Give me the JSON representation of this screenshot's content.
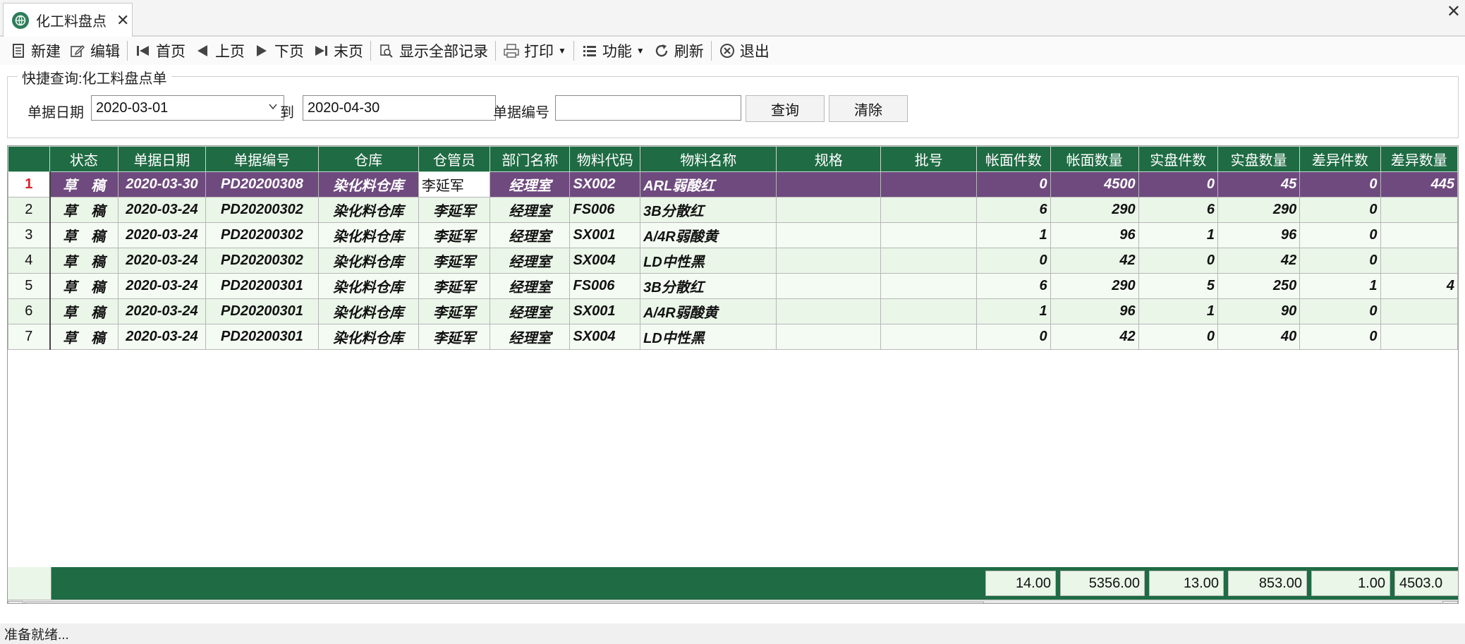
{
  "tab": {
    "title": "化工料盘点",
    "close": "✕"
  },
  "window": {
    "close": "✕"
  },
  "toolbar": {
    "new": "新建",
    "edit": "编辑",
    "first": "首页",
    "prev": "上页",
    "next": "下页",
    "last": "末页",
    "show_all": "显示全部记录",
    "print": "打印",
    "functions": "功能",
    "refresh": "刷新",
    "exit": "退出"
  },
  "icons": {
    "new": "document-icon",
    "edit": "edit-icon",
    "first": "first-page-icon",
    "prev": "prev-page-icon",
    "next": "next-page-icon",
    "last": "last-page-icon",
    "show_all": "search-icon",
    "print": "printer-icon",
    "functions": "list-icon",
    "refresh": "refresh-icon",
    "exit": "close-circle-icon"
  },
  "quick_search": {
    "legend": "快捷查询:化工料盘点单",
    "date_label": "单据日期",
    "date_from": "2020-03-01",
    "to_label": "到",
    "date_to": "2020-04-30",
    "number_label": "单据编号",
    "number_value": "",
    "query_button": "查询",
    "clear_button": "清除"
  },
  "grid": {
    "columns": [
      "状态",
      "单据日期",
      "单据编号",
      "仓库",
      "仓管员",
      "部门名称",
      "物料代码",
      "物料名称",
      "规格",
      "批号",
      "帐面件数",
      "帐面数量",
      "实盘件数",
      "实盘数量",
      "差异件数",
      "差异数量"
    ],
    "rows": [
      {
        "n": "1",
        "status": "草　稿",
        "date": "2020-03-30",
        "no": "PD20200308",
        "wh": "染化料仓库",
        "keeper": "李延军",
        "dept": "经理室",
        "code": "SX002",
        "name": "ARL弱酸红",
        "spec": "",
        "batch": "",
        "bk_pcs": "0",
        "bk_qty": "4500",
        "act_pcs": "0",
        "act_qty": "45",
        "diff_pcs": "0",
        "diff_qty": "445"
      },
      {
        "n": "2",
        "status": "草　稿",
        "date": "2020-03-24",
        "no": "PD20200302",
        "wh": "染化料仓库",
        "keeper": "李延军",
        "dept": "经理室",
        "code": "FS006",
        "name": "3B分散红",
        "spec": "",
        "batch": "",
        "bk_pcs": "6",
        "bk_qty": "290",
        "act_pcs": "6",
        "act_qty": "290",
        "diff_pcs": "0",
        "diff_qty": ""
      },
      {
        "n": "3",
        "status": "草　稿",
        "date": "2020-03-24",
        "no": "PD20200302",
        "wh": "染化料仓库",
        "keeper": "李延军",
        "dept": "经理室",
        "code": "SX001",
        "name": "A/4R弱酸黄",
        "spec": "",
        "batch": "",
        "bk_pcs": "1",
        "bk_qty": "96",
        "act_pcs": "1",
        "act_qty": "96",
        "diff_pcs": "0",
        "diff_qty": ""
      },
      {
        "n": "4",
        "status": "草　稿",
        "date": "2020-03-24",
        "no": "PD20200302",
        "wh": "染化料仓库",
        "keeper": "李延军",
        "dept": "经理室",
        "code": "SX004",
        "name": "LD中性黑",
        "spec": "",
        "batch": "",
        "bk_pcs": "0",
        "bk_qty": "42",
        "act_pcs": "0",
        "act_qty": "42",
        "diff_pcs": "0",
        "diff_qty": ""
      },
      {
        "n": "5",
        "status": "草　稿",
        "date": "2020-03-24",
        "no": "PD20200301",
        "wh": "染化料仓库",
        "keeper": "李延军",
        "dept": "经理室",
        "code": "FS006",
        "name": "3B分散红",
        "spec": "",
        "batch": "",
        "bk_pcs": "6",
        "bk_qty": "290",
        "act_pcs": "5",
        "act_qty": "250",
        "diff_pcs": "1",
        "diff_qty": "4"
      },
      {
        "n": "6",
        "status": "草　稿",
        "date": "2020-03-24",
        "no": "PD20200301",
        "wh": "染化料仓库",
        "keeper": "李延军",
        "dept": "经理室",
        "code": "SX001",
        "name": "A/4R弱酸黄",
        "spec": "",
        "batch": "",
        "bk_pcs": "1",
        "bk_qty": "96",
        "act_pcs": "1",
        "act_qty": "90",
        "diff_pcs": "0",
        "diff_qty": ""
      },
      {
        "n": "7",
        "status": "草　稿",
        "date": "2020-03-24",
        "no": "PD20200301",
        "wh": "染化料仓库",
        "keeper": "李延军",
        "dept": "经理室",
        "code": "SX004",
        "name": "LD中性黑",
        "spec": "",
        "batch": "",
        "bk_pcs": "0",
        "bk_qty": "42",
        "act_pcs": "0",
        "act_qty": "40",
        "diff_pcs": "0",
        "diff_qty": ""
      }
    ],
    "selected_row": 1,
    "totals": {
      "bk_pcs": "14.00",
      "bk_qty": "5356.00",
      "act_pcs": "13.00",
      "act_qty": "853.00",
      "diff_pcs": "1.00",
      "diff_qty": "4503.0"
    }
  },
  "scrollbar": {
    "left": "◀",
    "right": "▶"
  },
  "status_bar": "准备就绪..."
}
